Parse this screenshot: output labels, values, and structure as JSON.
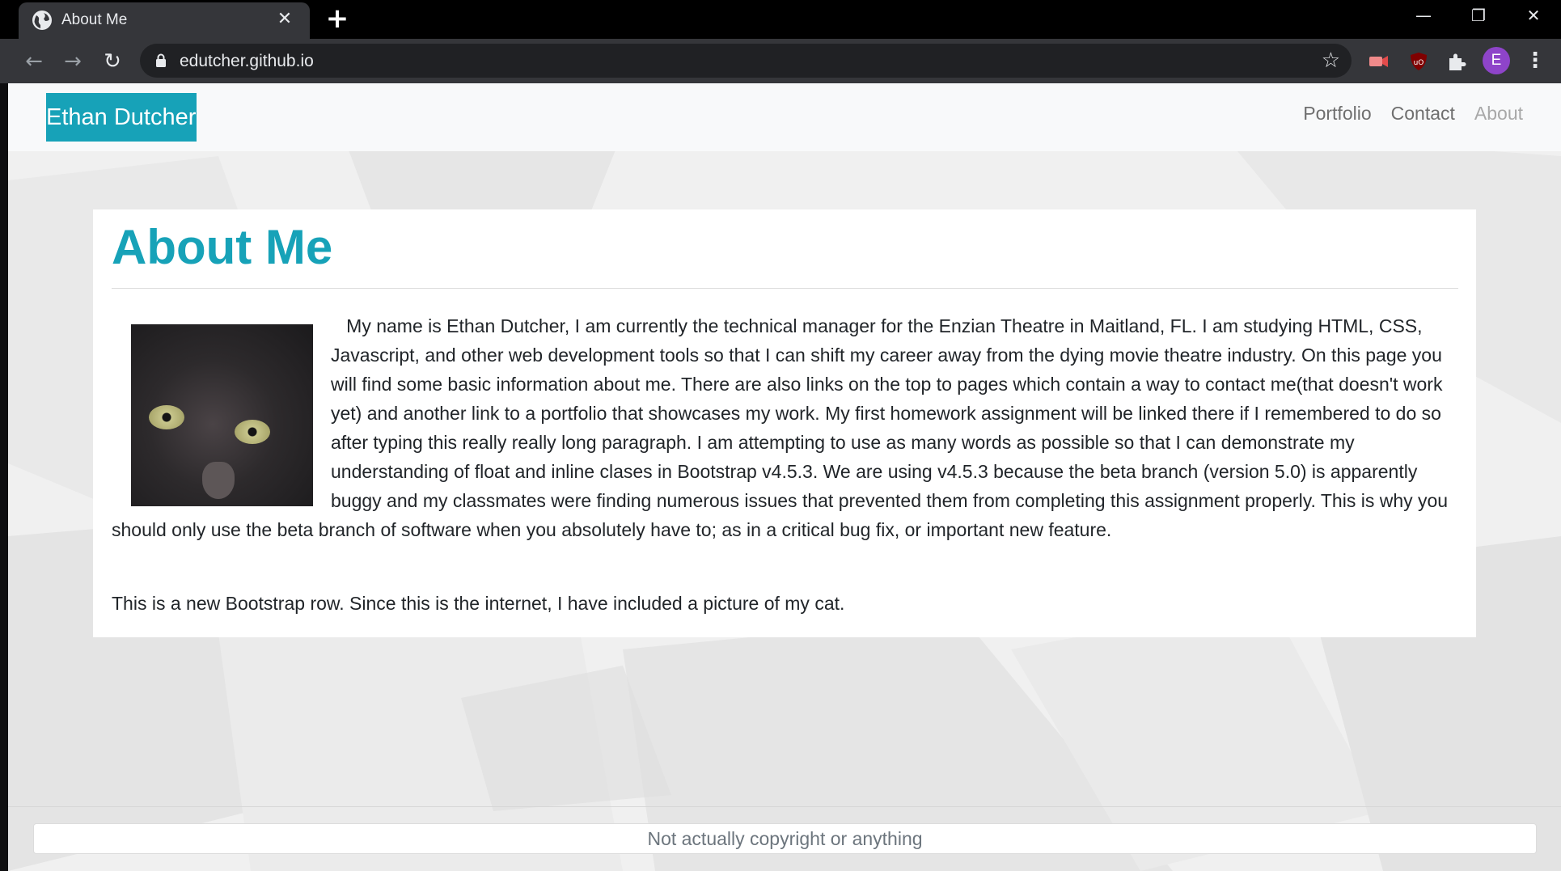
{
  "browser": {
    "tab_title": "About Me",
    "new_tab_glyph": "+",
    "close_glyph": "✕",
    "url": "edutcher.github.io",
    "profile_initial": "E",
    "window_controls": {
      "minimize": "—",
      "restore": "❐",
      "close": "✕"
    },
    "nav": {
      "back": "←",
      "forward": "→",
      "reload": "↻"
    },
    "star_glyph": "☆",
    "menu_glyph": "⋮"
  },
  "site": {
    "brand": "Ethan Dutcher",
    "nav_links": [
      "Portfolio",
      "Contact",
      "About"
    ],
    "active_link": "About",
    "accent_color": "#17a2b8"
  },
  "main": {
    "heading": "About Me",
    "paragraph": "   My name is Ethan Dutcher, I am currently the technical manager for the Enzian Theatre in Maitland, FL. I am studying HTML, CSS, Javascript, and other web development tools so that I can shift my career away from the dying movie theatre industry. On this page you will find some basic information about me. There are also links on the top to pages which contain a way to contact me(that doesn't work yet) and another link to a portfolio that showcases my work. My first homework assignment will be linked there if I remembered to do so after typing this really really long paragraph. I am attempting to use as many words as possible so that I can demonstrate my understanding of float and inline clases in Bootstrap v4.5.3. We are using v4.5.3 because the beta branch (version 5.0) is apparently buggy and my classmates were finding numerous issues that prevented them from completing this assignment properly. This is why you should only use the beta branch of software when you absolutely have to; as in a critical bug fix, or important new feature.",
    "paragraph2": "This is a new Bootstrap row. Since this is the internet, I have included a picture of my cat."
  },
  "footer": {
    "text": "Not actually copyright or anything"
  }
}
